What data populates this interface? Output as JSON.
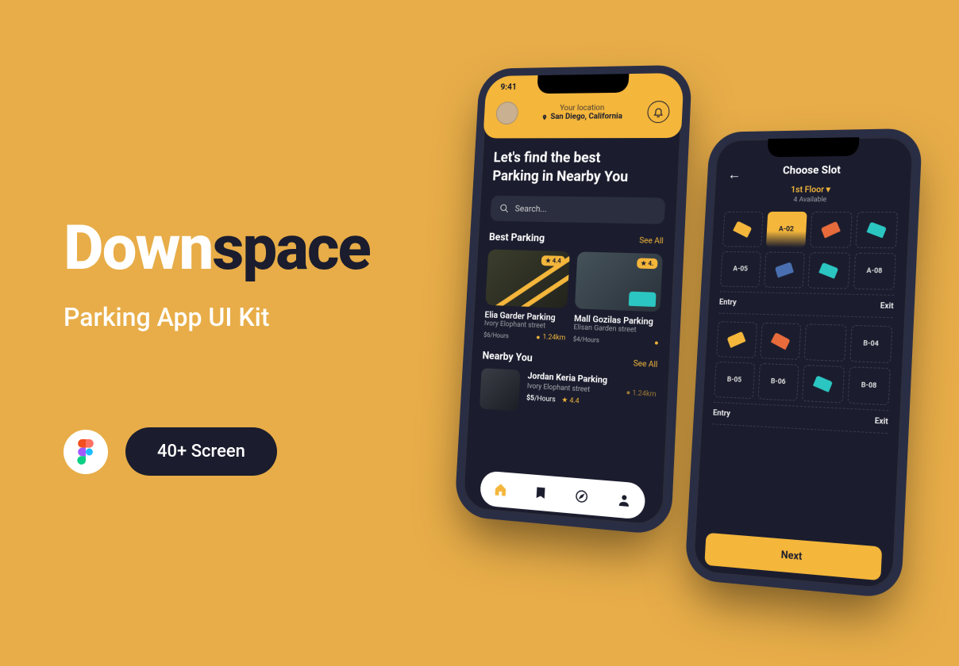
{
  "hero": {
    "title_part_1": "Down",
    "title_part_2": "space",
    "subtitle": "Parking App UI Kit",
    "cta_label": "40+ Screen"
  },
  "phone1": {
    "status_time": "9:41",
    "location_label": "Your location",
    "location_value": "San Diego, California",
    "headline": "Let's find the best\nParking in Nearby You",
    "search_placeholder": "Search...",
    "best_heading": "Best Parking",
    "see_all": "See All",
    "cards": [
      {
        "name": "Elia Garder Parking",
        "street": "Ivory Elophant street",
        "price": "$6",
        "per": "Hours",
        "rating": "4.4",
        "distance": "1.24km"
      },
      {
        "name": "Mall Gozilas Parking",
        "street": "Elisan Garden street",
        "price": "$4",
        "per": "Hours",
        "rating": "4.",
        "distance": ""
      }
    ],
    "nearby_heading": "Nearby You",
    "nearby": {
      "name": "Jordan Keria Parking",
      "street": "Ivory Elophant street",
      "price": "$5",
      "per": "Hours",
      "rating": "4.4",
      "distance": "1.24km"
    }
  },
  "phone2": {
    "title": "Choose Slot",
    "floor": "1st Floor",
    "available": "4 Available",
    "rowsA": [
      "",
      "A-02",
      "",
      "",
      "A-05",
      "",
      "",
      "A-08"
    ],
    "rowsB": [
      "",
      "",
      "",
      "B-04",
      "B-05",
      "B-06",
      "",
      "B-08"
    ],
    "entry": "Entry",
    "exit": "Exit",
    "next": "Next"
  }
}
